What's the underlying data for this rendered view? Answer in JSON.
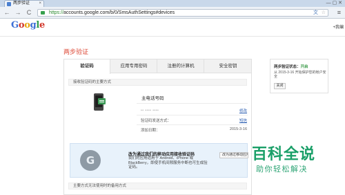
{
  "browser": {
    "tab_title": "两步验证",
    "tab_close": "×",
    "window_controls": "— ▢ ✕",
    "nav_back": "←",
    "nav_forward": "→",
    "nav_reload": "C",
    "url_scheme": "https://",
    "url_rest": "accounts.google.com/b/0/SmsAuthSettings#devices",
    "icons": [
      "lock-icon",
      "translate-icon",
      "star-icon",
      "menu-icon"
    ]
  },
  "header": {
    "logo_letters": [
      "G",
      "o",
      "o",
      "g",
      "l",
      "e"
    ],
    "account_link": "+我编"
  },
  "page": {
    "title": "两步验证",
    "tabs": [
      "验证码",
      "应用专用密码",
      "注册的计算机",
      "安全密钥"
    ],
    "active_tab": 0,
    "section_primary": "接收验证码的主要方式",
    "phone_label": "主电话号码",
    "phone_masked": "•• •••• ••••",
    "edit_link": "修改",
    "send_method_label": "验证码发送方式：",
    "send_method_link": "短信",
    "added_label": "添加日期：",
    "added_date": "2015-3-16",
    "promo": {
      "title": "改为通过我们的移动应用接收验证码",
      "text": "我们的应用适用于 Android、iPhone 或 BlackBerry，即使手机间隙服务中断也可生成验证码。",
      "button": "改为通过移动应用接收"
    },
    "section_backup": "主要方式无法使用时的备用方式"
  },
  "side_panel": {
    "status_label": "两步验证状态：",
    "status_value": "开启",
    "since": "从 2015-3-16 开始保护您的帐户安全",
    "button": "关闭"
  },
  "watermark": {
    "title": "百科全说",
    "subtitle": "助你轻松解决"
  },
  "colors": {
    "accent_red": "#dd4b39",
    "status_green": "#3c9b4a",
    "link_blue": "#2a5db0",
    "watermark_green": "#1a9f68"
  }
}
